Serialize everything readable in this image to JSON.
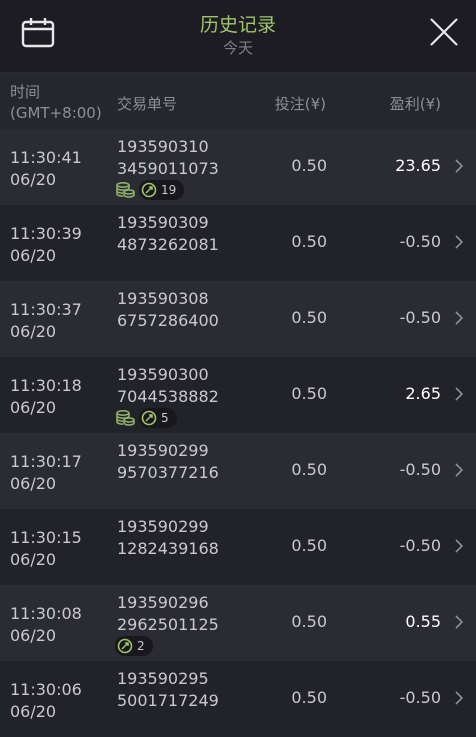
{
  "header": {
    "title": "历史记录",
    "subtitle": "今天",
    "calendar_icon": "calendar-icon",
    "close_icon": "close-icon",
    "title_color": "#9fc46b"
  },
  "columns": {
    "time": "时间",
    "timezone": "(GMT+8:00)",
    "order_no": "交易单号",
    "bet": "投注(¥)",
    "profit": "盈利(¥)"
  },
  "rows": [
    {
      "time": "11:30:41",
      "date": "06/20",
      "order_line1": "193590310",
      "order_line2": "3459011073",
      "bet": "0.50",
      "profit": "23.65",
      "win": true,
      "coin": true,
      "count": "19"
    },
    {
      "time": "11:30:39",
      "date": "06/20",
      "order_line1": "193590309",
      "order_line2": "4873262081",
      "bet": "0.50",
      "profit": "-0.50",
      "win": false
    },
    {
      "time": "11:30:37",
      "date": "06/20",
      "order_line1": "193590308",
      "order_line2": "6757286400",
      "bet": "0.50",
      "profit": "-0.50",
      "win": false
    },
    {
      "time": "11:30:18",
      "date": "06/20",
      "order_line1": "193590300",
      "order_line2": "7044538882",
      "bet": "0.50",
      "profit": "2.65",
      "win": true,
      "coin": true,
      "count": "5"
    },
    {
      "time": "11:30:17",
      "date": "06/20",
      "order_line1": "193590299",
      "order_line2": "9570377216",
      "bet": "0.50",
      "profit": "-0.50",
      "win": false
    },
    {
      "time": "11:30:15",
      "date": "06/20",
      "order_line1": "193590299",
      "order_line2": "1282439168",
      "bet": "0.50",
      "profit": "-0.50",
      "win": false
    },
    {
      "time": "11:30:08",
      "date": "06/20",
      "order_line1": "193590296",
      "order_line2": "2962501125",
      "bet": "0.50",
      "profit": "0.55",
      "win": true,
      "coin": false,
      "count": "2"
    },
    {
      "time": "11:30:06",
      "date": "06/20",
      "order_line1": "193590295",
      "order_line2": "5001717249",
      "bet": "0.50",
      "profit": "-0.50",
      "win": false
    }
  ]
}
